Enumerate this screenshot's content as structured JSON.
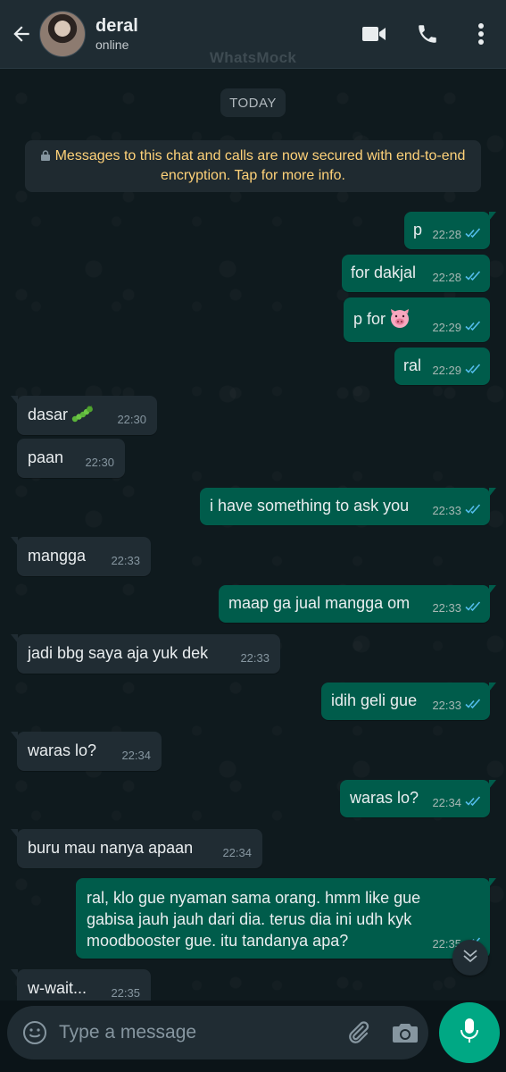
{
  "header": {
    "contact_name": "deral",
    "status": "online",
    "watermark": "WhatsMock"
  },
  "chat": {
    "day_label": "TODAY",
    "encryption_notice": "Messages to this chat and calls are now secured with end-to-end encryption. Tap for more info.",
    "messages": [
      {
        "dir": "out",
        "text": "p",
        "time": "22:28",
        "status": "read"
      },
      {
        "dir": "out",
        "text": "for dakjal",
        "time": "22:28",
        "status": "read"
      },
      {
        "dir": "out",
        "text": "p for",
        "emoji": "pig-face",
        "time": "22:29",
        "status": "read"
      },
      {
        "dir": "out",
        "text": "ral",
        "time": "22:29",
        "status": "read"
      },
      {
        "dir": "in",
        "text": "dasar",
        "emoji": "caterpillar",
        "time": "22:30"
      },
      {
        "dir": "in",
        "text": "paan",
        "time": "22:30"
      },
      {
        "dir": "out",
        "text": "i have something to ask you",
        "time": "22:33",
        "status": "read"
      },
      {
        "dir": "in",
        "text": "mangga",
        "time": "22:33"
      },
      {
        "dir": "out",
        "text": "maap ga jual mangga om",
        "time": "22:33",
        "status": "read"
      },
      {
        "dir": "in",
        "text": "jadi bbg saya aja yuk dek",
        "time": "22:33"
      },
      {
        "dir": "out",
        "text": "idih geli gue",
        "time": "22:33",
        "status": "read"
      },
      {
        "dir": "in",
        "text": "waras lo?",
        "time": "22:34"
      },
      {
        "dir": "out",
        "text": "waras lo?",
        "time": "22:34",
        "status": "read"
      },
      {
        "dir": "in",
        "text": "buru mau nanya apaan",
        "time": "22:34"
      },
      {
        "dir": "out",
        "text": "ral, klo gue nyaman sama orang. hmm like gue gabisa jauh jauh dari dia. terus dia ini udh kyk moodbooster gue. itu tandanya apa?",
        "time": "22:35",
        "status": "read"
      },
      {
        "dir": "in",
        "text": "w-wait...",
        "time": "22:35"
      }
    ]
  },
  "composer": {
    "placeholder": "Type a message"
  },
  "colors": {
    "header_bg": "#1f2c33",
    "outgoing_bubble": "#005c4b",
    "incoming_bubble": "#202c33",
    "read_tick": "#53bdeb",
    "notice_text": "#ffd279",
    "mic_button": "#00a884"
  }
}
